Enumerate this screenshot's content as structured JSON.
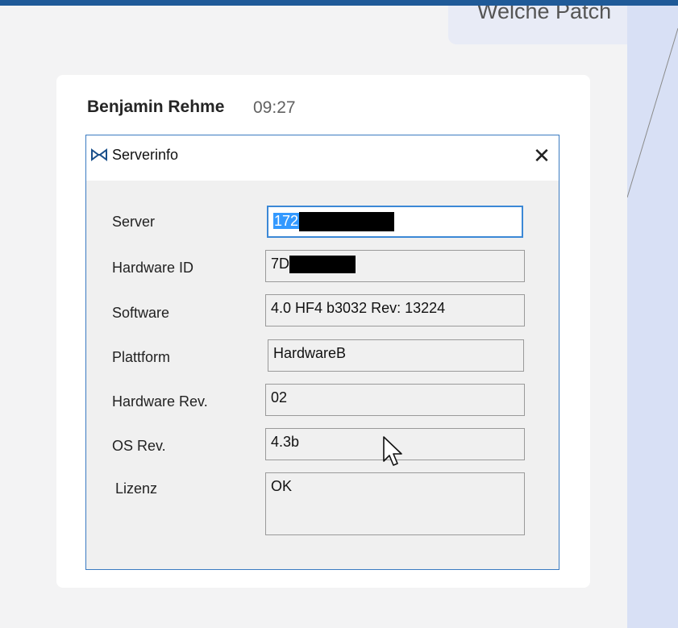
{
  "top_message": {
    "text": "Welche Patch"
  },
  "message": {
    "sender": "Benjamin Rehme",
    "time": "09:27"
  },
  "dialog": {
    "title": "Serverinfo",
    "close_glyph": "✕",
    "app_icon": "server-app-icon",
    "rows": {
      "server": {
        "label": "Server",
        "value": "172"
      },
      "hardware_id": {
        "label": "Hardware ID",
        "value": "7D"
      },
      "software": {
        "label": "Software",
        "value": "4.0 HF4 b3032 Rev: 13224"
      },
      "plattform": {
        "label": "Plattform",
        "value": "HardwareB"
      },
      "hardware_rev": {
        "label": "Hardware Rev.",
        "value": "02"
      },
      "os_rev": {
        "label": "OS Rev.",
        "value": "4.3b"
      },
      "lizenz": {
        "label": "Lizenz",
        "value": "OK"
      }
    }
  },
  "colors": {
    "accent": "#1f5a98",
    "selection": "#3399ff",
    "window_border": "#3a7ac1"
  }
}
